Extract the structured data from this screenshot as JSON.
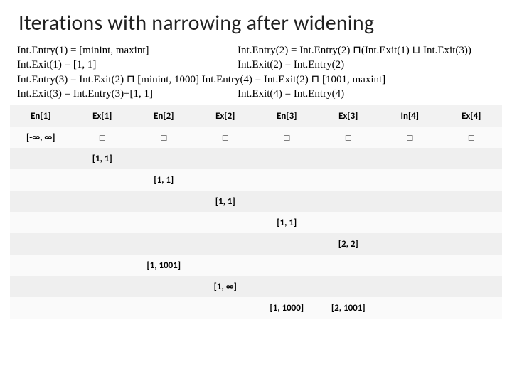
{
  "title": "Iterations  with narrowing after widening",
  "equations": {
    "r1c1": "Int.Entry(1) = [minint, maxint]",
    "r1c2": "Int.Entry(2) = Int.Entry(2) ⊓(Int.Exit(1) ⊔ Int.Exit(3))",
    "r2c1": "Int.Exit(1) = [1, 1]",
    "r2c2": "Int.Exit(2) = Int.Entry(2)",
    "r3": "Int.Entry(3) = Int.Exit(2) ⊓ [minint, 1000]   Int.Entry(4) = Int.Exit(2) ⊓ [1001, maxint]",
    "r4c1": "Int.Exit(3) = Int.Entry(3)+[1, 1]",
    "r4c2": "Int.Exit(4) = Int.Entry(4)"
  },
  "headers": [
    "En[1]",
    "Ex[1]",
    "En[2]",
    "Ex[2]",
    "En[3]",
    "Ex[3]",
    "In[4]",
    "Ex[4]"
  ],
  "rows": [
    [
      "[-∞, ∞]",
      "□",
      "□",
      "□",
      "□",
      "□",
      "□",
      "□"
    ],
    [
      "",
      "[1, 1]",
      "",
      "",
      "",
      "",
      "",
      ""
    ],
    [
      "",
      "",
      "[1, 1]",
      "",
      "",
      "",
      "",
      ""
    ],
    [
      "",
      "",
      "",
      "[1, 1]",
      "",
      "",
      "",
      ""
    ],
    [
      "",
      "",
      "",
      "",
      "[1, 1]",
      "",
      "",
      ""
    ],
    [
      "",
      "",
      "",
      "",
      "",
      "[2, 2]",
      "",
      ""
    ],
    [
      "",
      "",
      "[1, 1001]",
      "",
      "",
      "",
      "",
      ""
    ],
    [
      "",
      "",
      "",
      "[1, ∞]",
      "",
      "",
      "",
      ""
    ],
    [
      "",
      "",
      "",
      "",
      "[1, 1000]",
      "[2, 1001]",
      "",
      ""
    ]
  ]
}
